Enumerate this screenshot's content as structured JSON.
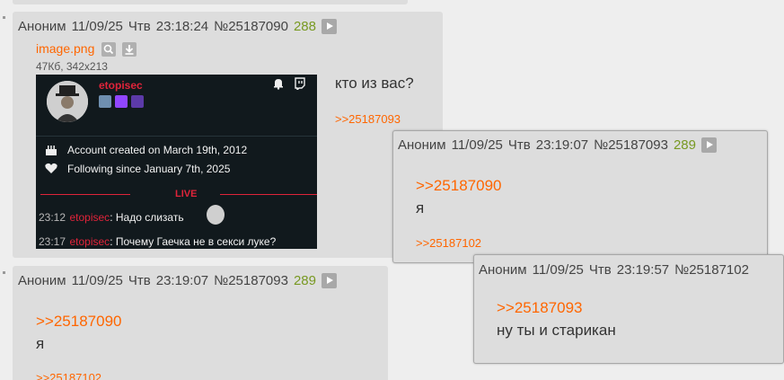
{
  "post1": {
    "author": "Аноним",
    "date": "11/09/25",
    "day": "Чтв",
    "time": "23:18:24",
    "num": "№25187090",
    "count": "288",
    "file_name": "image.png",
    "file_meta": "47Кб, 342x213",
    "text": "кто из вас?",
    "reply_link": ">>25187093",
    "card": {
      "username": "etopisec",
      "account_created": "Account created on March 19th, 2012",
      "following_since": "Following since January 7th, 2025",
      "live": "LIVE",
      "chat": [
        {
          "time": "23:12",
          "nick": "etopisec",
          "msg": ": Надо слизать"
        },
        {
          "time": "23:17",
          "nick": "etopisec",
          "msg": ": Почему Гаечка не в секси луке?"
        }
      ]
    }
  },
  "post2": {
    "author": "Аноним",
    "date": "11/09/25",
    "day": "Чтв",
    "time": "23:19:07",
    "num": "№25187093",
    "count": "289",
    "quote": ">>25187090",
    "text": "я",
    "reply_link": ">>25187102"
  },
  "popup1": {
    "author": "Аноним",
    "date": "11/09/25",
    "day": "Чтв",
    "time": "23:19:07",
    "num": "№25187093",
    "count": "289",
    "quote": ">>25187090",
    "text": "я",
    "reply_link": ">>25187102"
  },
  "popup2": {
    "author": "Аноним",
    "date": "11/09/25",
    "day": "Чтв",
    "time": "23:19:57",
    "num": "№25187102",
    "quote": ">>25187093",
    "text": "ну ты и старикан"
  },
  "colors": {
    "post_bg": "#dddddd",
    "page_bg": "#eeeeee",
    "link": "#ff6600",
    "counter": "#789922",
    "twitch_red": "#e0243a"
  }
}
